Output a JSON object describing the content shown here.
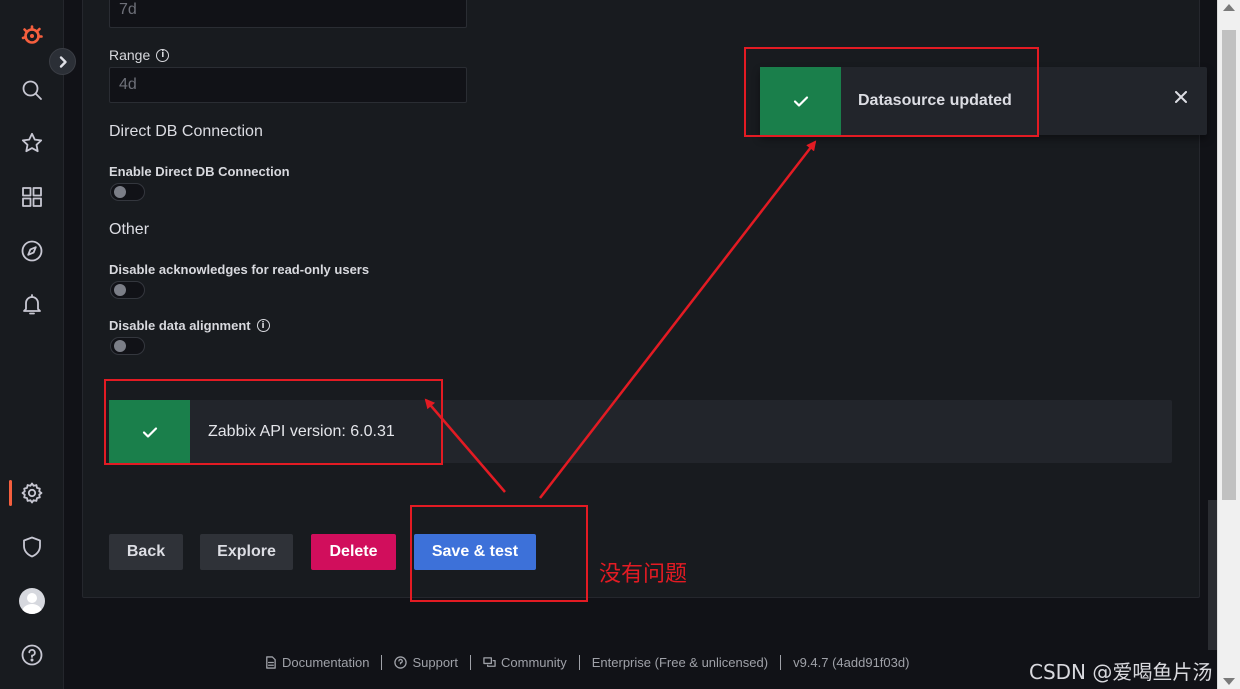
{
  "app": {
    "brand_color": "#f55f3e"
  },
  "sidebar": {
    "items": [
      {
        "icon": "grafana-logo-icon"
      },
      {
        "icon": "search-icon"
      },
      {
        "icon": "star-icon"
      },
      {
        "icon": "dashboards-icon"
      },
      {
        "icon": "compass-icon"
      },
      {
        "icon": "bell-icon"
      },
      {
        "icon": "gear-icon",
        "active": true
      },
      {
        "icon": "shield-icon"
      },
      {
        "icon": "avatar"
      },
      {
        "icon": "help-icon"
      }
    ]
  },
  "form": {
    "ttl_value": "7d",
    "range_label": "Range",
    "range_value": "4d",
    "direct_db_title": "Direct DB Connection",
    "enable_direct_db_label": "Enable Direct DB Connection",
    "other_title": "Other",
    "disable_ack_label": "Disable acknowledges for read-only users",
    "disable_alignment_label": "Disable data alignment"
  },
  "alert": {
    "text": "Zabbix API version: 6.0.31",
    "color": "#1a7f4b"
  },
  "buttons": {
    "back": "Back",
    "explore": "Explore",
    "delete": "Delete",
    "save_test": "Save & test"
  },
  "toast": {
    "text": "Datasource updated"
  },
  "footer": {
    "documentation": "Documentation",
    "support": "Support",
    "community": "Community",
    "enterprise": "Enterprise (Free & unlicensed)",
    "version": "v9.4.7 (4add91f03d)"
  },
  "annotation": {
    "note": "没有问题",
    "color": "#e31b23"
  },
  "watermark": "CSDN @爱喝鱼片汤"
}
